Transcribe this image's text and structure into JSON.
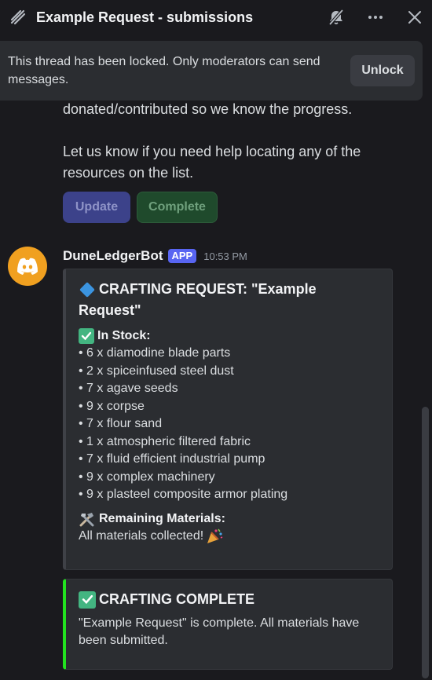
{
  "header": {
    "title": "Example Request - submissions"
  },
  "banner": {
    "text": "This thread has been locked. Only moderators can send messages.",
    "unlock_label": "Unlock"
  },
  "previous_message": {
    "line1": "donated/contributed so we know the progress.",
    "line2": "Let us know if you need help locating any of the resources on the list.",
    "buttons": {
      "update": "Update",
      "complete": "Complete"
    }
  },
  "bot_message": {
    "username": "DuneLedgerBot",
    "badge": "APP",
    "timestamp": "10:53 PM",
    "embed1": {
      "title": "CRAFTING REQUEST: \"Example Request\"",
      "in_stock_label": "In Stock:",
      "items": [
        "• 6 x diamodine blade parts",
        "• 2 x spiceinfused steel dust",
        "• 7 x agave seeds",
        "• 9 x corpse",
        "• 7 x flour sand",
        "• 1 x atmospheric filtered fabric",
        "• 7 x fluid efficient industrial pump",
        "• 9 x complex machinery",
        "• 9 x plasteel composite armor plating"
      ],
      "remaining_label": "Remaining Materials:",
      "remaining_text": "All materials collected!"
    },
    "embed2": {
      "title": "CRAFTING COMPLETE",
      "description": "\"Example Request\" is complete. All materials have been submitted."
    }
  },
  "colors": {
    "accent": "#5865f2",
    "complete_bar": "#22e31f",
    "avatar_bg": "#f0a020"
  }
}
